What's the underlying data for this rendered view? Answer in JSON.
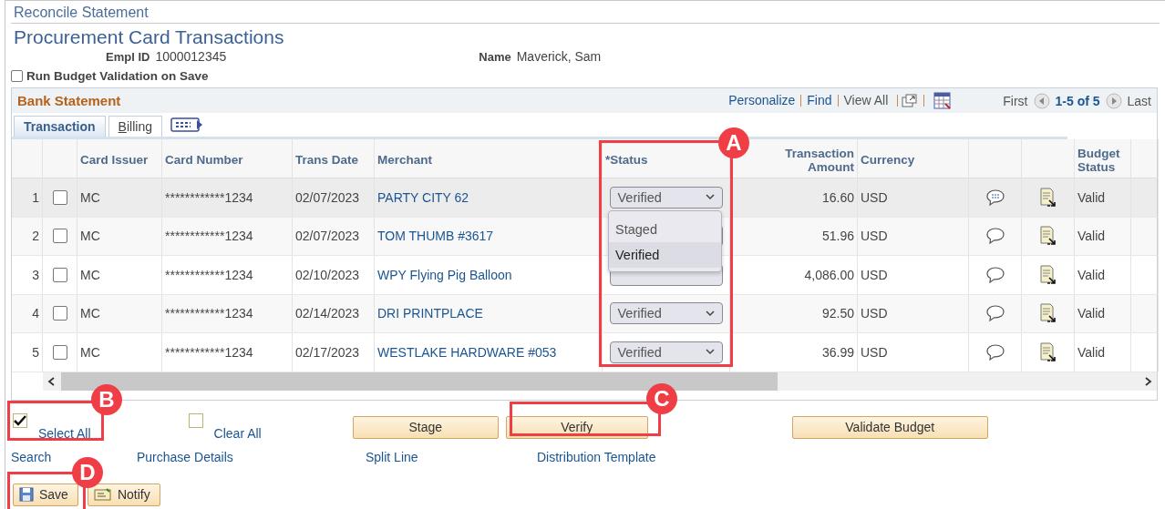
{
  "breadcrumb": "Reconcile Statement",
  "page_title": "Procurement Card Transactions",
  "fields": [
    {
      "label": "Empl ID",
      "value": "1000012345"
    },
    {
      "label": "Name",
      "value": "Maverick, Sam"
    }
  ],
  "budget_validation": {
    "label": "Run Budget Validation on Save",
    "checked": false
  },
  "grid": {
    "title": "Bank Statement",
    "toolbar": [
      "Personalize",
      "Find",
      "View All"
    ],
    "nav": {
      "first": "First",
      "range": "1-5 of 5",
      "last": "Last"
    },
    "tabs": [
      {
        "label": "Transaction",
        "selected": true
      },
      {
        "label": "Billing",
        "selected": false
      }
    ],
    "columns": {
      "issuer": "Card Issuer",
      "card": "Card Number",
      "date": "Trans Date",
      "merchant": "Merchant",
      "status": "*Status",
      "amount": "Transaction Amount",
      "currency": "Currency",
      "budget": "Budget Status"
    },
    "rows": [
      {
        "num": "1",
        "checked": false,
        "highlighted": true,
        "issuer": "MC",
        "card": "************1234",
        "date": "02/07/2023",
        "merchant": "PARTY CITY 62",
        "status": "Verified",
        "amount": "16.60",
        "currency": "USD",
        "has_comment": true,
        "budget": "Valid"
      },
      {
        "num": "2",
        "checked": false,
        "highlighted": false,
        "issuer": "MC",
        "card": "************1234",
        "date": "02/07/2023",
        "merchant": "TOM THUMB #3617",
        "amount": "51.96",
        "currency": "USD",
        "has_comment": false,
        "budget": "Valid"
      },
      {
        "num": "3",
        "checked": false,
        "highlighted": false,
        "issuer": "MC",
        "card": "************1234",
        "date": "02/10/2023",
        "merchant": "WPY Flying Pig Balloon",
        "amount": "4,086.00",
        "currency": "USD",
        "has_comment": false,
        "budget": "Valid"
      },
      {
        "num": "4",
        "checked": false,
        "highlighted": false,
        "issuer": "MC",
        "card": "************1234",
        "date": "02/14/2023",
        "merchant": "DRI PRINTPLACE",
        "status": "Verified",
        "amount": "92.50",
        "currency": "USD",
        "has_comment": false,
        "budget": "Valid"
      },
      {
        "num": "5",
        "checked": false,
        "highlighted": false,
        "issuer": "MC",
        "card": "************1234",
        "date": "02/17/2023",
        "merchant": "WESTLAKE HARDWARE #053",
        "status": "Verified",
        "amount": "36.99",
        "currency": "USD",
        "has_comment": false,
        "budget": "Valid"
      }
    ],
    "dropdown": {
      "options": [
        {
          "label": "Staged",
          "selected": false
        },
        {
          "label": "Verified",
          "selected": true
        }
      ]
    }
  },
  "selection": [
    {
      "label": "Select All",
      "checked": true
    },
    {
      "label": "Clear All",
      "checked": false
    }
  ],
  "buttons": [
    "Stage",
    "Verify",
    "Validate Budget"
  ],
  "links": [
    "Search",
    "Purchase Details",
    "Split Line",
    "Distribution Template"
  ],
  "footer_buttons": [
    {
      "label": "Save",
      "kind": "save"
    },
    {
      "label": "Notify",
      "kind": "notify"
    }
  ],
  "annotations": [
    {
      "letter": "A",
      "kind": "status"
    },
    {
      "letter": "B",
      "kind": "select_all"
    },
    {
      "letter": "C",
      "kind": "verify"
    },
    {
      "letter": "D",
      "kind": "save"
    }
  ]
}
